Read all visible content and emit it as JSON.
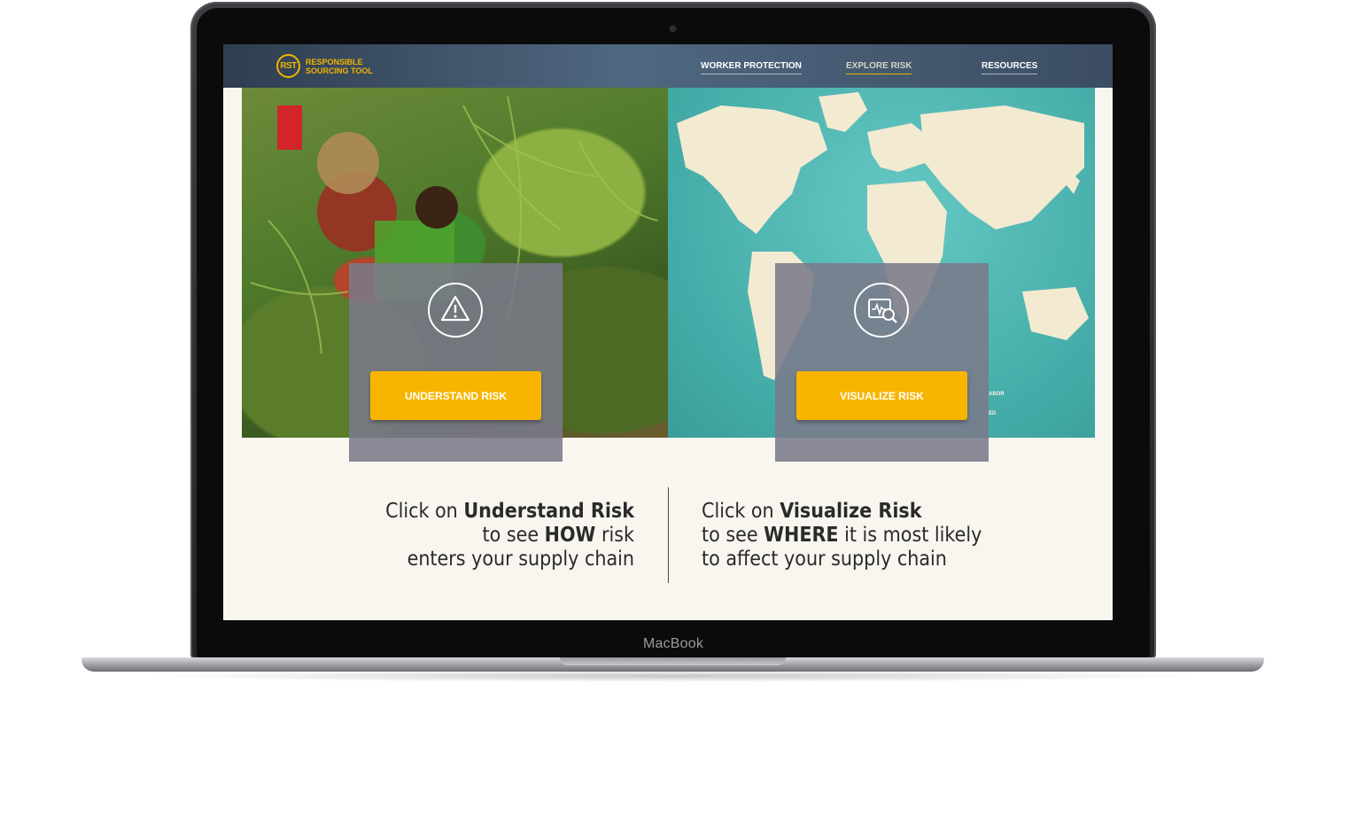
{
  "device": {
    "label": "MacBook"
  },
  "navbar": {
    "logo_mark": "RST",
    "logo_line1": "RESPONSIBLE",
    "logo_line2": "SOURCING TOOL",
    "links": [
      {
        "label": "WORKER PROTECTION",
        "active": false
      },
      {
        "label": "EXPLORE RISK",
        "active": true
      },
      {
        "label": "RESOURCES",
        "active": false
      }
    ],
    "colors": {
      "accent": "#f0b400"
    }
  },
  "cards": [
    {
      "icon": "warning-icon",
      "button_label": "UNDERSTAND RISK"
    },
    {
      "icon": "monitor-search-icon",
      "button_label": "VISUALIZE RISK"
    }
  ],
  "map_legend": {
    "line1": "ABOR",
    "line2": "ED"
  },
  "descriptions": {
    "left": {
      "l1_pre": "Click on ",
      "l1_bold": "Understand Risk",
      "l2_pre": "to see ",
      "l2_bold": "HOW",
      "l2_post": " risk",
      "l3": "enters your supply chain"
    },
    "right": {
      "l1_pre": "Click on ",
      "l1_bold": "Visualize Risk",
      "l2_pre": "to see ",
      "l2_bold": "WHERE",
      "l2_post": " it is most likely",
      "l3": "to affect your supply chain"
    }
  },
  "colors": {
    "button": "#f7b500",
    "ocean": "#4fb8b4",
    "land": "#f3ead2"
  }
}
